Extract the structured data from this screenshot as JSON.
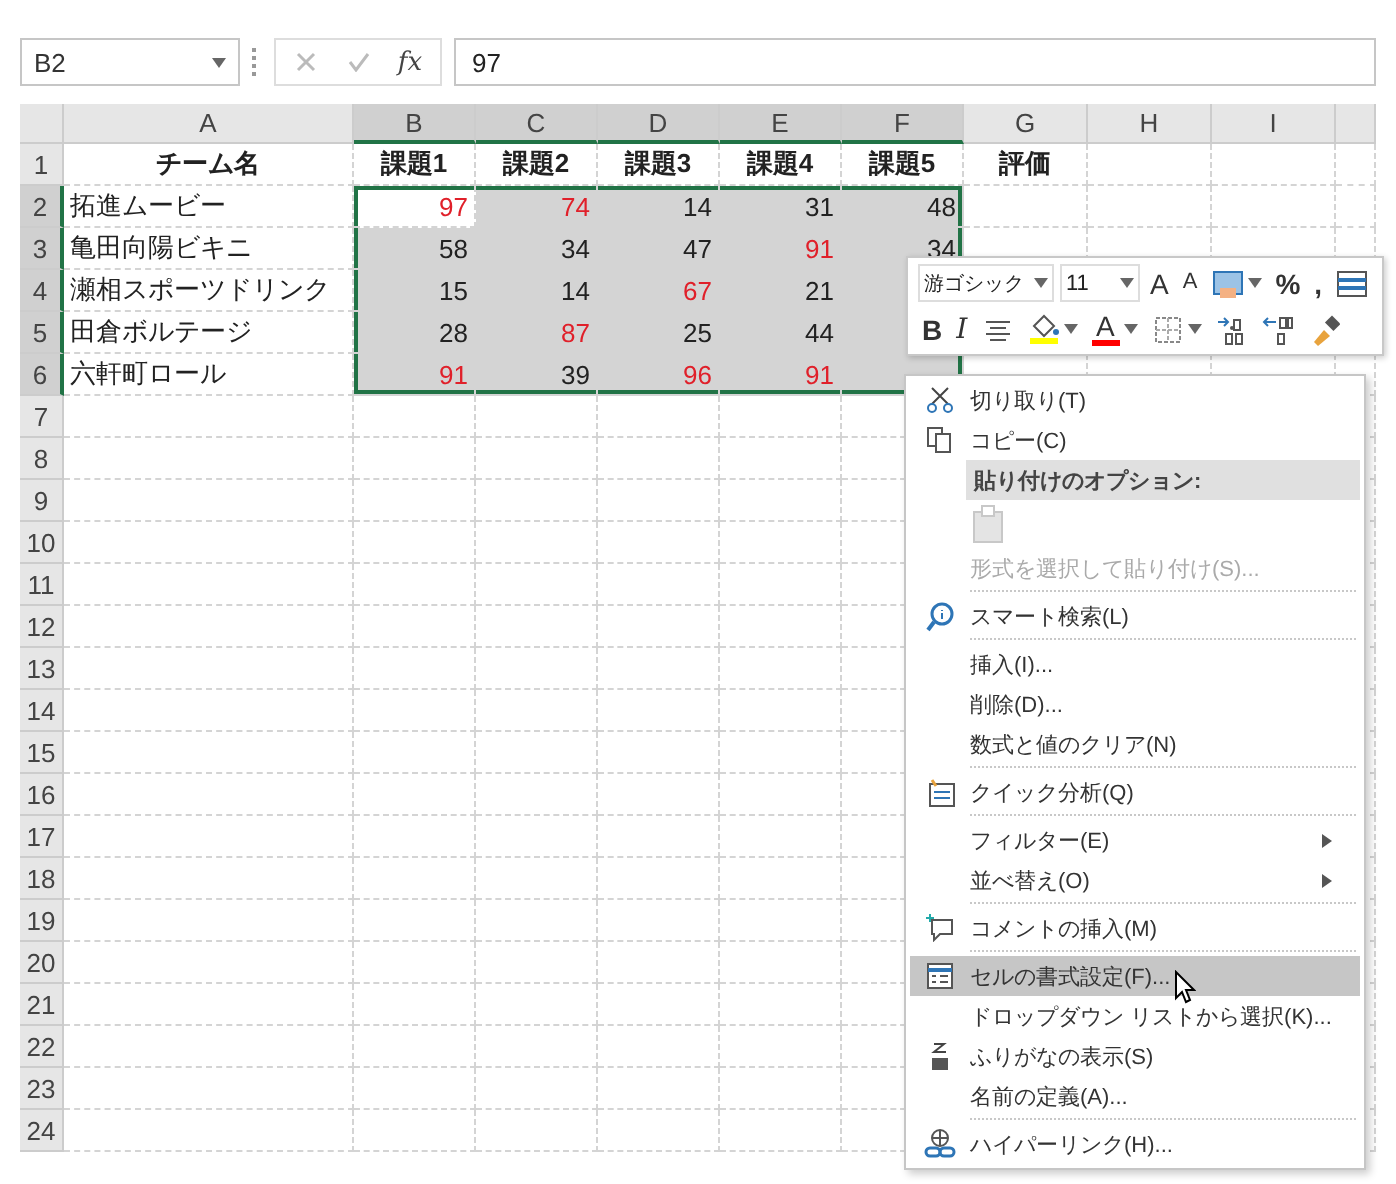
{
  "formula_bar": {
    "name_box": "B2",
    "function_button": "fx",
    "formula": "97"
  },
  "columns": [
    {
      "label": "A",
      "selected": false
    },
    {
      "label": "B",
      "selected": true
    },
    {
      "label": "C",
      "selected": true
    },
    {
      "label": "D",
      "selected": true
    },
    {
      "label": "E",
      "selected": true
    },
    {
      "label": "F",
      "selected": true
    },
    {
      "label": "G",
      "selected": false
    },
    {
      "label": "H",
      "selected": false
    },
    {
      "label": "I",
      "selected": false
    }
  ],
  "rows": [
    {
      "number": "1",
      "selected": false,
      "cells": [
        {
          "kind": "header",
          "text": "チーム名"
        },
        {
          "kind": "header",
          "text": "課題1"
        },
        {
          "kind": "header",
          "text": "課題2"
        },
        {
          "kind": "header",
          "text": "課題3"
        },
        {
          "kind": "header",
          "text": "課題4"
        },
        {
          "kind": "header",
          "text": "課題5"
        },
        {
          "kind": "header",
          "text": "評価"
        }
      ]
    },
    {
      "number": "2",
      "selected": true,
      "cells": [
        {
          "kind": "text",
          "text": "拓進ムービー"
        },
        {
          "kind": "number",
          "text": "97",
          "flagged": true,
          "active": true
        },
        {
          "kind": "number",
          "text": "74",
          "flagged": true,
          "active": false
        },
        {
          "kind": "number",
          "text": "14",
          "flagged": false,
          "active": false
        },
        {
          "kind": "number",
          "text": "31",
          "flagged": false,
          "active": false
        },
        {
          "kind": "number",
          "text": "48",
          "flagged": false,
          "active": false
        }
      ]
    },
    {
      "number": "3",
      "selected": true,
      "cells": [
        {
          "kind": "text",
          "text": "亀田向陽ビキニ"
        },
        {
          "kind": "number",
          "text": "58",
          "flagged": false,
          "active": false
        },
        {
          "kind": "number",
          "text": "34",
          "flagged": false,
          "active": false
        },
        {
          "kind": "number",
          "text": "47",
          "flagged": false,
          "active": false
        },
        {
          "kind": "number",
          "text": "91",
          "flagged": true,
          "active": false
        },
        {
          "kind": "number",
          "text": "34",
          "flagged": false,
          "active": false
        }
      ]
    },
    {
      "number": "4",
      "selected": true,
      "cells": [
        {
          "kind": "text",
          "text": "瀬相スポーツドリンク"
        },
        {
          "kind": "number",
          "text": "15",
          "flagged": false,
          "active": false
        },
        {
          "kind": "number",
          "text": "14",
          "flagged": false,
          "active": false
        },
        {
          "kind": "number",
          "text": "67",
          "flagged": true,
          "active": false
        },
        {
          "kind": "number",
          "text": "21",
          "flagged": false,
          "active": false
        },
        null
      ]
    },
    {
      "number": "5",
      "selected": true,
      "cells": [
        {
          "kind": "text",
          "text": "田倉ボルテージ"
        },
        {
          "kind": "number",
          "text": "28",
          "flagged": false,
          "active": false
        },
        {
          "kind": "number",
          "text": "87",
          "flagged": true,
          "active": false
        },
        {
          "kind": "number",
          "text": "25",
          "flagged": false,
          "active": false
        },
        {
          "kind": "number",
          "text": "44",
          "flagged": false,
          "active": false
        },
        null
      ]
    },
    {
      "number": "6",
      "selected": true,
      "cells": [
        {
          "kind": "text",
          "text": "六軒町ロール"
        },
        {
          "kind": "number",
          "text": "91",
          "flagged": true,
          "active": false
        },
        {
          "kind": "number",
          "text": "39",
          "flagged": false,
          "active": false
        },
        {
          "kind": "number",
          "text": "96",
          "flagged": true,
          "active": false
        },
        {
          "kind": "number",
          "text": "91",
          "flagged": true,
          "active": false
        },
        null
      ]
    },
    {
      "number": "7",
      "selected": false,
      "cells": []
    },
    {
      "number": "8",
      "selected": false,
      "cells": []
    },
    {
      "number": "9",
      "selected": false,
      "cells": []
    },
    {
      "number": "10",
      "selected": false,
      "cells": []
    },
    {
      "number": "11",
      "selected": false,
      "cells": []
    },
    {
      "number": "12",
      "selected": false,
      "cells": []
    },
    {
      "number": "13",
      "selected": false,
      "cells": []
    },
    {
      "number": "14",
      "selected": false,
      "cells": []
    },
    {
      "number": "15",
      "selected": false,
      "cells": []
    },
    {
      "number": "16",
      "selected": false,
      "cells": []
    },
    {
      "number": "17",
      "selected": false,
      "cells": []
    },
    {
      "number": "18",
      "selected": false,
      "cells": []
    },
    {
      "number": "19",
      "selected": false,
      "cells": []
    },
    {
      "number": "20",
      "selected": false,
      "cells": []
    },
    {
      "number": "21",
      "selected": false,
      "cells": []
    },
    {
      "number": "22",
      "selected": false,
      "cells": []
    },
    {
      "number": "23",
      "selected": false,
      "cells": []
    },
    {
      "number": "24",
      "selected": false,
      "cells": []
    }
  ],
  "mini_toolbar": {
    "font": "游ゴシック",
    "size": "11",
    "row1": [
      {
        "kind": "grow",
        "glyph": "A",
        "dropdown": false
      },
      {
        "kind": "shrink",
        "glyph": "A",
        "dropdown": false
      },
      {
        "kind": "styles",
        "dropdown": true
      },
      {
        "kind": "percent",
        "glyph": "%",
        "dropdown": false
      },
      {
        "kind": "comma",
        "glyph": ",",
        "dropdown": false
      },
      {
        "kind": "format",
        "dropdown": false
      }
    ],
    "row2": [
      {
        "kind": "bold",
        "glyph": "B",
        "dropdown": false
      },
      {
        "kind": "italic",
        "glyph": "I",
        "dropdown": false
      },
      {
        "kind": "center",
        "dropdown": false
      },
      {
        "kind": "fill",
        "color": "#ffff00",
        "dropdown": true
      },
      {
        "kind": "fontcolor",
        "glyph": "A",
        "color": "#ff0000",
        "dropdown": true
      },
      {
        "kind": "border",
        "dropdown": true
      },
      {
        "kind": "incdec",
        "dropdown": false
      },
      {
        "kind": "decdec",
        "dropdown": false
      },
      {
        "kind": "painter",
        "dropdown": false
      }
    ]
  },
  "context_menu": [
    {
      "kind": "item",
      "label": "切り取り(T)",
      "disabled": false,
      "selected": false,
      "submenu": false
    },
    {
      "kind": "item",
      "label": "コピー(C)",
      "disabled": false,
      "selected": false,
      "submenu": false
    },
    {
      "kind": "header",
      "label": "貼り付けのオプション:"
    },
    {
      "kind": "paste-options",
      "disabled": true
    },
    {
      "kind": "item",
      "label": "形式を選択して貼り付け(S)...",
      "disabled": true,
      "selected": false,
      "submenu": false
    },
    {
      "kind": "separator"
    },
    {
      "kind": "item",
      "label": "スマート検索(L)",
      "disabled": false,
      "selected": false,
      "submenu": false
    },
    {
      "kind": "separator"
    },
    {
      "kind": "item",
      "label": "挿入(I)...",
      "disabled": false,
      "selected": false,
      "submenu": false
    },
    {
      "kind": "item",
      "label": "削除(D)...",
      "disabled": false,
      "selected": false,
      "submenu": false
    },
    {
      "kind": "item",
      "label": "数式と値のクリア(N)",
      "disabled": false,
      "selected": false,
      "submenu": false
    },
    {
      "kind": "separator"
    },
    {
      "kind": "item",
      "label": "クイック分析(Q)",
      "disabled": false,
      "selected": false,
      "submenu": false
    },
    {
      "kind": "separator"
    },
    {
      "kind": "item",
      "label": "フィルター(E)",
      "disabled": false,
      "selected": false,
      "submenu": true
    },
    {
      "kind": "item",
      "label": "並べ替え(O)",
      "disabled": false,
      "selected": false,
      "submenu": true
    },
    {
      "kind": "separator"
    },
    {
      "kind": "item",
      "label": "コメントの挿入(M)",
      "disabled": false,
      "selected": false,
      "submenu": false
    },
    {
      "kind": "separator"
    },
    {
      "kind": "item",
      "label": "セルの書式設定(F)...",
      "disabled": false,
      "selected": true,
      "submenu": false
    },
    {
      "kind": "item",
      "label": "ドロップダウン リストから選択(K)...",
      "disabled": false,
      "selected": false,
      "submenu": false
    },
    {
      "kind": "item",
      "label": "ふりがなの表示(S)",
      "disabled": false,
      "selected": false,
      "submenu": false
    },
    {
      "kind": "item",
      "label": "名前の定義(A)...",
      "disabled": false,
      "selected": false,
      "submenu": false
    },
    {
      "kind": "separator"
    },
    {
      "kind": "item",
      "label": "ハイパーリンク(H)...",
      "disabled": false,
      "selected": false,
      "submenu": false
    }
  ]
}
